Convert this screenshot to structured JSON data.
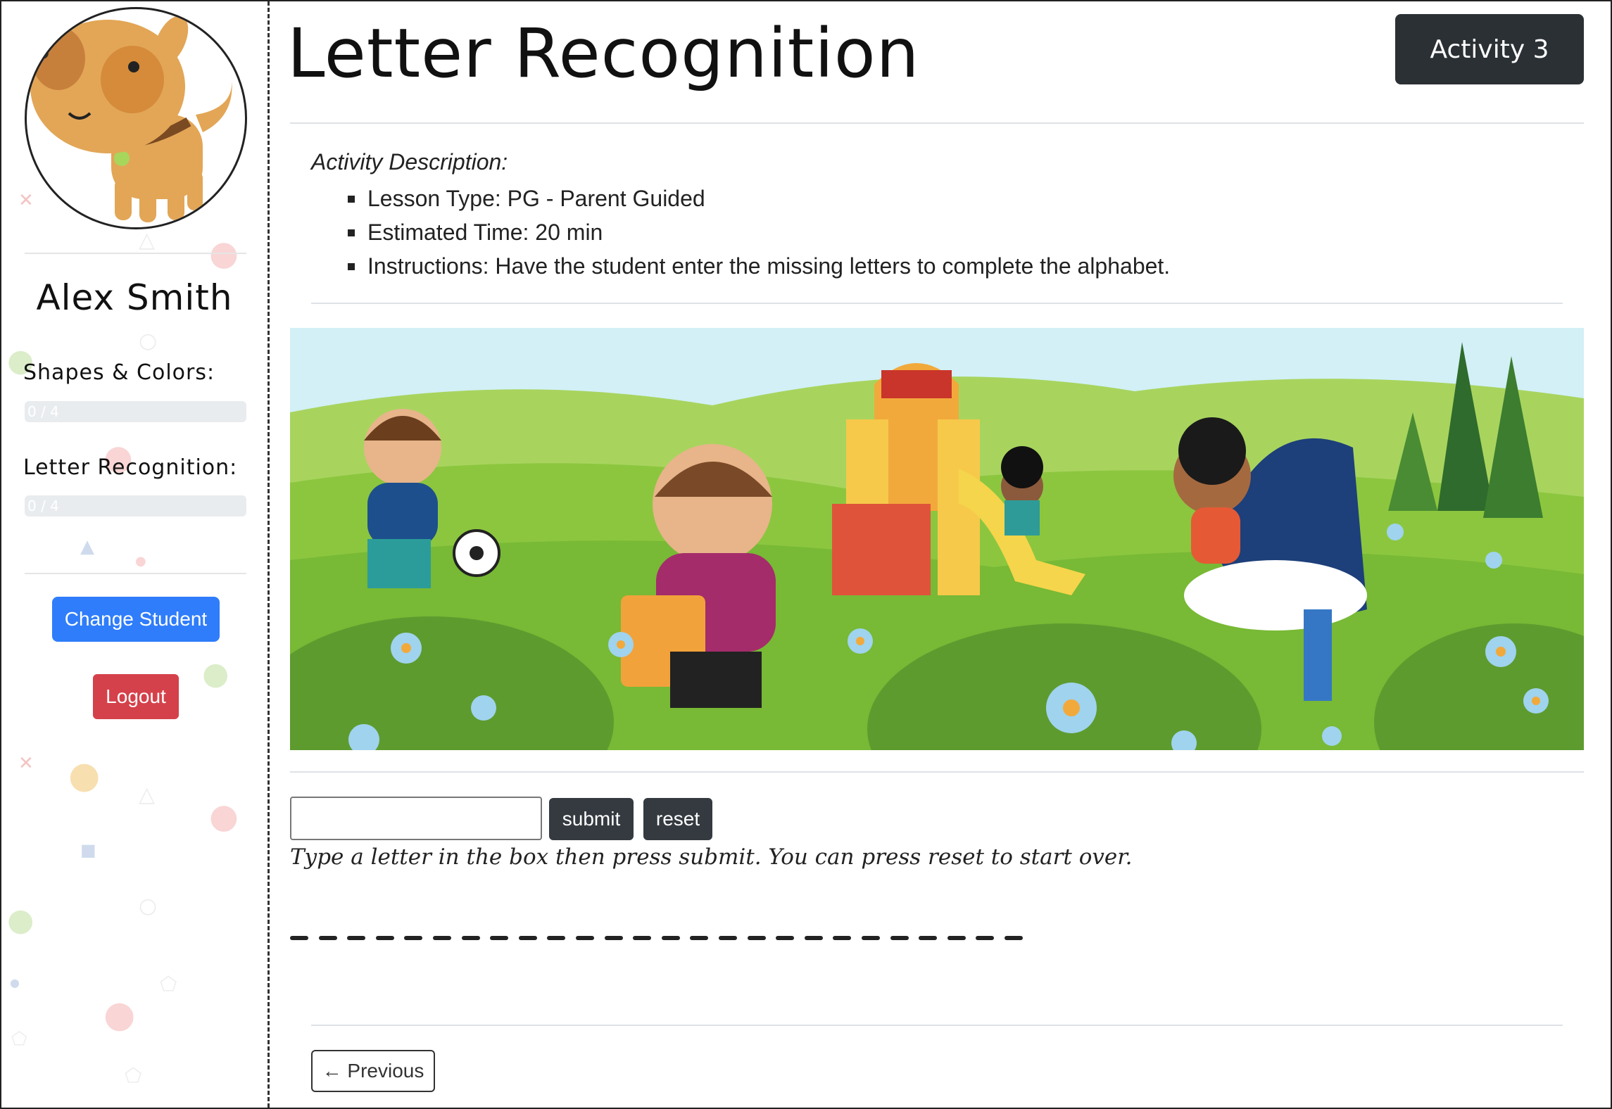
{
  "student": {
    "name": "Alex Smith"
  },
  "progress": [
    {
      "label": "Shapes & Colors:",
      "text": "0 / 4",
      "value": 0
    },
    {
      "label": "Letter Recognition:",
      "text": "0 / 4",
      "value": 0
    }
  ],
  "sidebar": {
    "change_student_label": "Change Student",
    "logout_label": "Logout"
  },
  "header": {
    "title": "Letter Recognition",
    "activity_label": "Activity 3"
  },
  "description": {
    "label": "Activity Description:",
    "items": [
      "Lesson Type: PG - Parent Guided",
      "Estimated Time: 20 min",
      "Instructions: Have the student enter the missing letters to complete the alphabet."
    ]
  },
  "controls": {
    "input_value": "",
    "submit_label": "submit",
    "reset_label": "reset",
    "hint": "Type a letter in the box then press submit. You can press reset to start over."
  },
  "alphabet_blanks": 26,
  "nav": {
    "previous_label": "← Previous"
  },
  "colors": {
    "primary": "#2f7dfa",
    "danger": "#d5414a",
    "dark": "#343a40",
    "badge": "#2b3035"
  }
}
